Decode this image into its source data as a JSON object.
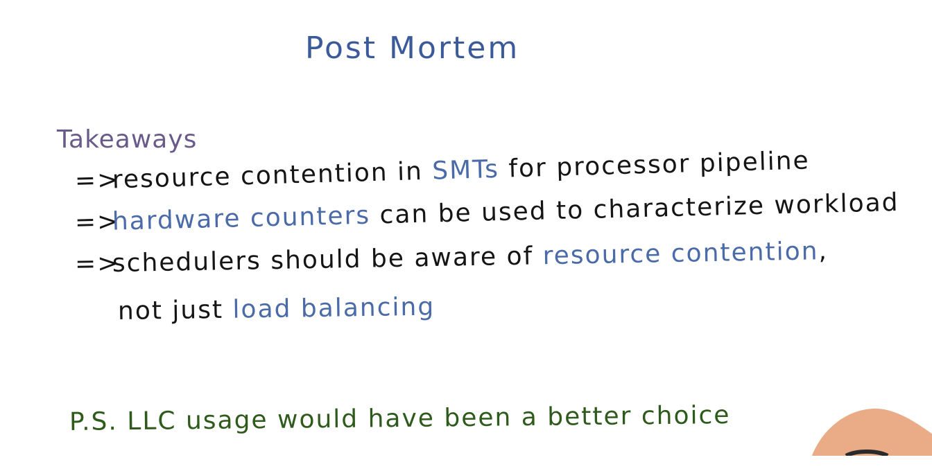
{
  "slide": {
    "title": "Post Mortem",
    "section_heading": "Takeaways",
    "arrow_glyph": "=>",
    "takeaways": [
      {
        "parts": [
          "resource contention in ",
          "SMTs",
          " for processor pipeline"
        ]
      },
      {
        "parts": [
          "",
          "hardware counters",
          " can be used to characterize workload"
        ]
      },
      {
        "parts": [
          "schedulers should be aware of ",
          "resource contention",
          ","
        ]
      },
      {
        "parts": [
          "not just ",
          "load balancing",
          ""
        ]
      }
    ],
    "postscript": "P.S. LLC usage would have been a better choice"
  },
  "colors": {
    "title": "#3a5a9a",
    "heading": "#6a5a8a",
    "body": "#151515",
    "highlight": "#4a6aa8",
    "postscript": "#2e5a1c"
  }
}
